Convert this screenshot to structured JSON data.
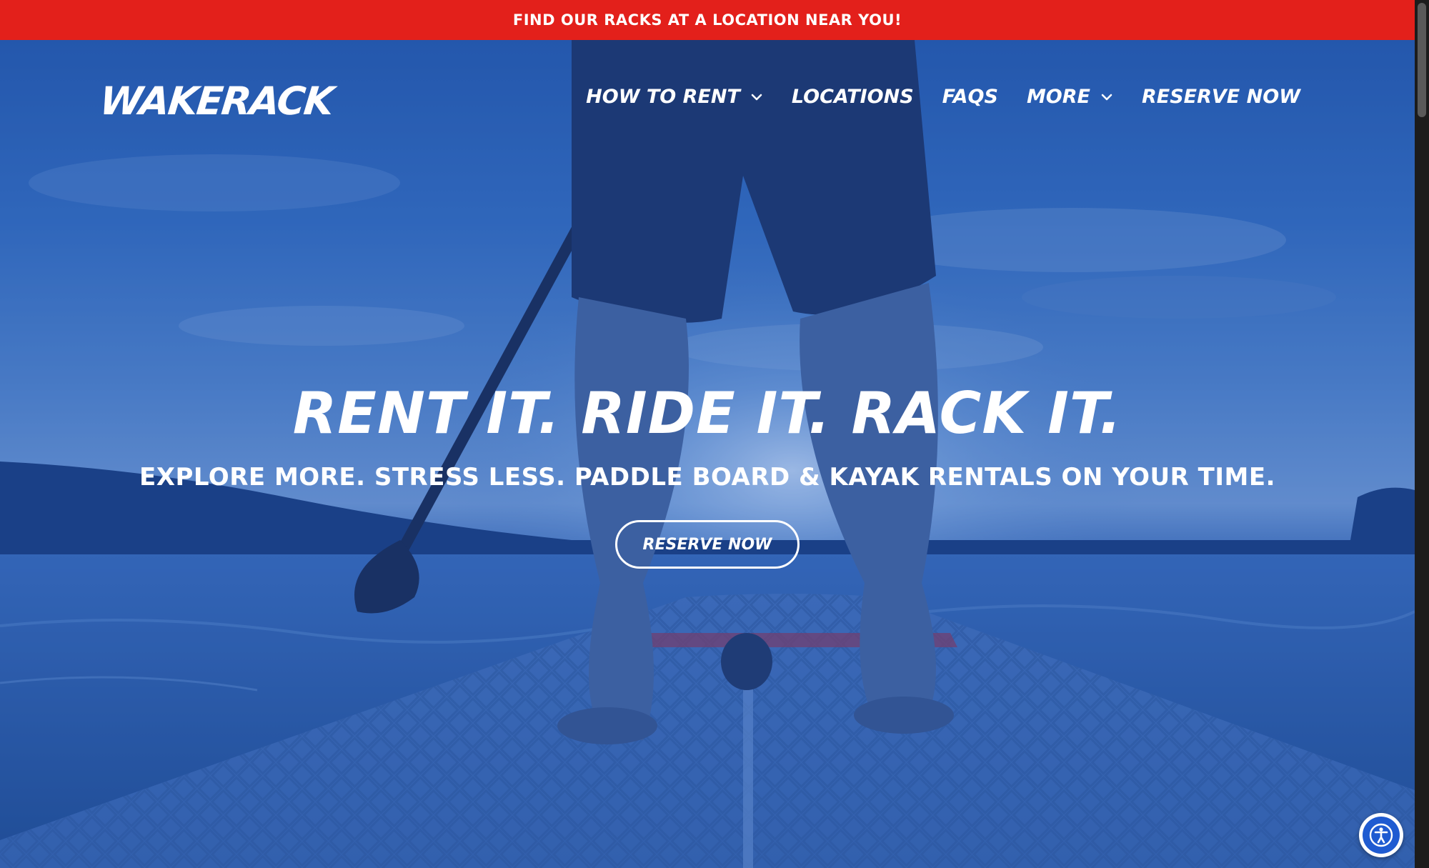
{
  "announcement": {
    "text": "FIND OUR RACKS AT A LOCATION NEAR YOU!",
    "background": "#e3201b"
  },
  "header": {
    "logo": "WAKERACK",
    "nav": [
      {
        "label": "HOW TO RENT",
        "has_dropdown": true
      },
      {
        "label": "LOCATIONS",
        "has_dropdown": false
      },
      {
        "label": "FAQS",
        "has_dropdown": false
      },
      {
        "label": "MORE",
        "has_dropdown": true
      },
      {
        "label": "RESERVE NOW",
        "has_dropdown": false
      }
    ]
  },
  "hero": {
    "headline": "RENT IT. RIDE IT. RACK IT.",
    "subheadline": "EXPLORE MORE. STRESS LESS. PADDLE BOARD & KAYAK RENTALS ON YOUR TIME.",
    "cta_label": "RESERVE NOW",
    "overlay_color": "#1a50b4"
  },
  "widgets": {
    "accessibility_icon": "accessibility-icon"
  }
}
